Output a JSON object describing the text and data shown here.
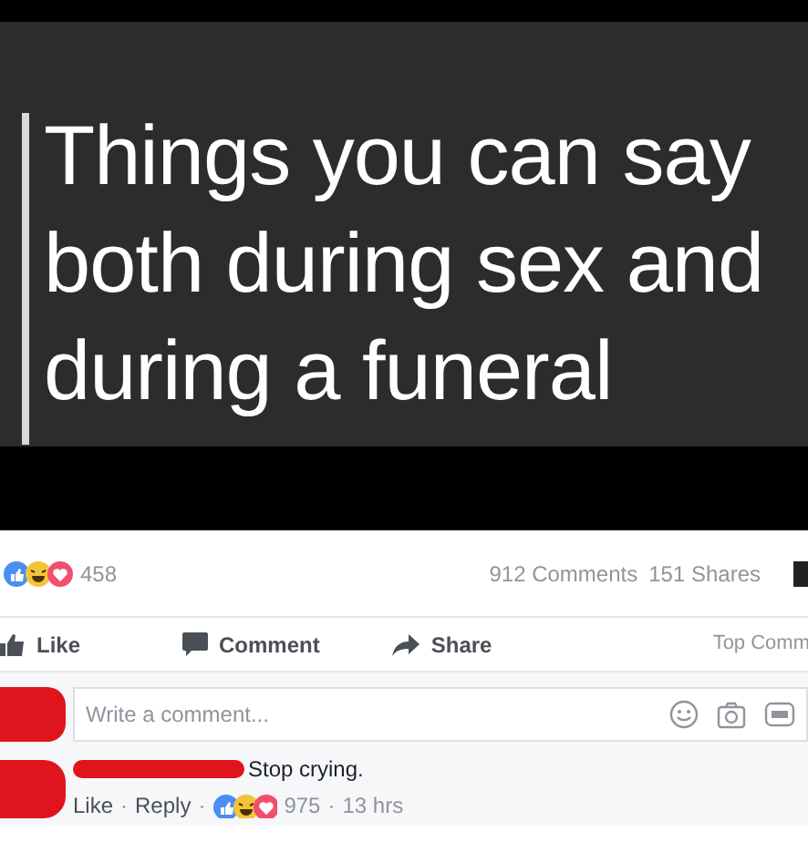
{
  "post_image": {
    "lines": [
      "Things you can say",
      "both during sex and",
      "during a funeral"
    ]
  },
  "stats": {
    "reactions_count": "458",
    "comments": "912 Comments",
    "shares": "151 Shares"
  },
  "actions": [
    {
      "kind": "like",
      "label": "Like"
    },
    {
      "kind": "comment",
      "label": "Comment"
    },
    {
      "kind": "share",
      "label": "Share"
    }
  ],
  "sort": "Top Comm",
  "composer": {
    "placeholder": "Write a comment..."
  },
  "comment": {
    "text": "Stop crying.",
    "actions": [
      "Like",
      "Reply"
    ],
    "separators": [
      "·",
      "·",
      "·"
    ],
    "reactions_count": "975",
    "time": "13 hrs"
  }
}
